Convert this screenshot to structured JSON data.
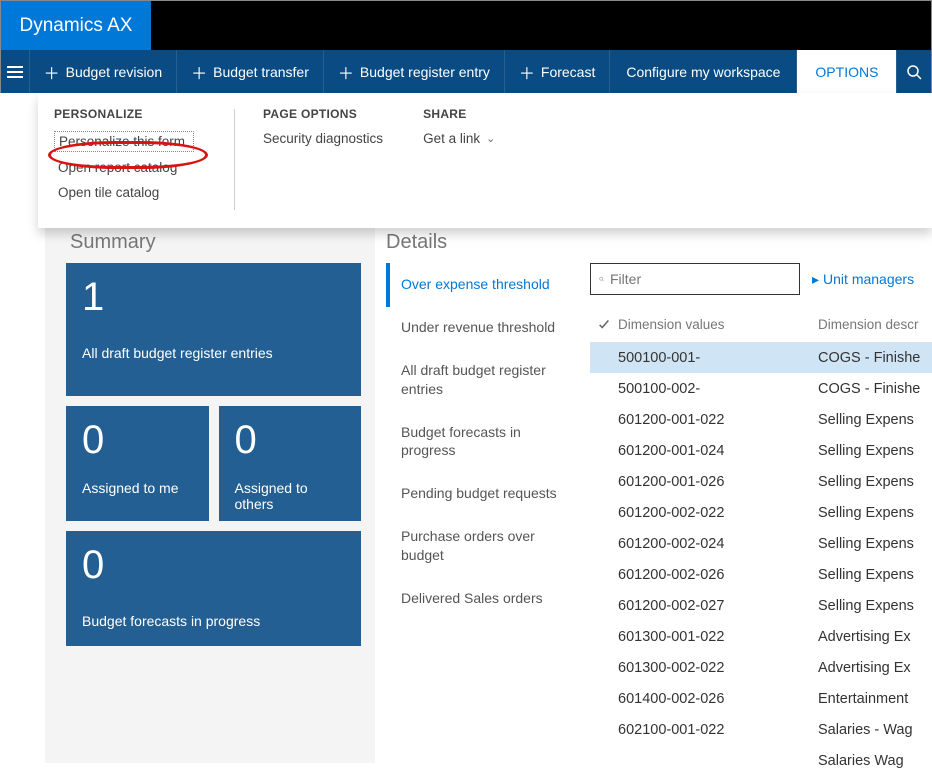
{
  "brand": {
    "title": "Dynamics AX"
  },
  "actionbar": {
    "budget_revision": "Budget revision",
    "budget_transfer": "Budget transfer",
    "budget_register_entry": "Budget register entry",
    "forecast": "Forecast",
    "configure_workspace": "Configure my workspace",
    "options": "OPTIONS"
  },
  "options_panel": {
    "personalize_header": "PERSONALIZE",
    "personalize_items": [
      "Personalize this form",
      "Open report catalog",
      "Open tile catalog"
    ],
    "page_options_header": "PAGE OPTIONS",
    "page_options_items": [
      "Security diagnostics"
    ],
    "share_header": "SHARE",
    "share_items": [
      "Get a link"
    ]
  },
  "sections": {
    "summary": "Summary",
    "details": "Details"
  },
  "tiles": {
    "draft_entries": {
      "count": "1",
      "label": "All draft budget register entries"
    },
    "assigned_me": {
      "count": "0",
      "label": "Assigned to me"
    },
    "assigned_others": {
      "count": "0",
      "label": "Assigned to others"
    },
    "forecasts_progress": {
      "count": "0",
      "label": "Budget forecasts in progress"
    }
  },
  "details_nav": [
    "Over expense threshold",
    "Under revenue threshold",
    "All draft budget register entries",
    "Budget forecasts in progress",
    "Pending budget requests",
    "Purchase orders over budget",
    "Delivered Sales orders"
  ],
  "filter": {
    "placeholder": "Filter"
  },
  "unit_managers_link": "Unit managers",
  "table": {
    "headers": {
      "dim_values": "Dimension values",
      "dim_descr": "Dimension descr"
    },
    "rows": [
      {
        "dim": "500100-001-",
        "descr": "COGS - Finishe",
        "selected": true
      },
      {
        "dim": "500100-002-",
        "descr": "COGS - Finishe"
      },
      {
        "dim": "601200-001-022",
        "descr": "Selling Expens"
      },
      {
        "dim": "601200-001-024",
        "descr": "Selling Expens"
      },
      {
        "dim": "601200-001-026",
        "descr": "Selling Expens"
      },
      {
        "dim": "601200-002-022",
        "descr": "Selling Expens"
      },
      {
        "dim": "601200-002-024",
        "descr": "Selling Expens"
      },
      {
        "dim": "601200-002-026",
        "descr": "Selling Expens"
      },
      {
        "dim": "601200-002-027",
        "descr": "Selling Expens"
      },
      {
        "dim": "601300-001-022",
        "descr": "Advertising Ex"
      },
      {
        "dim": "601300-002-022",
        "descr": "Advertising Ex"
      },
      {
        "dim": "601400-002-026",
        "descr": "Entertainment"
      },
      {
        "dim": "602100-001-022",
        "descr": "Salaries - Wag"
      },
      {
        "dim": "",
        "descr": "Salaries   Wag"
      }
    ]
  }
}
